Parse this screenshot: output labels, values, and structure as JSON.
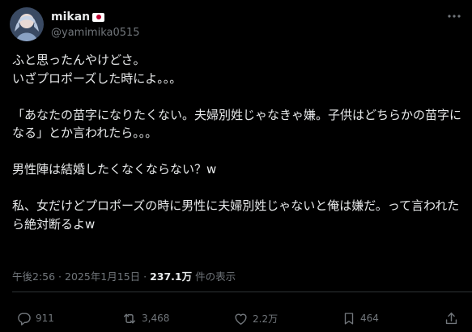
{
  "author": {
    "display_name": "mikan",
    "handle": "@yamimika0515",
    "flag": "japan-flag"
  },
  "post": {
    "text": "ふと思ったんやけどさ。\nいざプロポーズした時によ。。。\n\n「あなたの苗字になりたくない。夫婦別姓じゃなきゃ嫌。子供はどちらかの苗字になる」とか言われたら。。。\n\n男性陣は結婚したくなくならない？w\n\n私、女だけどプロポーズの時に男性に夫婦別姓じゃないと俺は嫌だ。って言われたら絶対断るよw"
  },
  "meta": {
    "timestamp": "午後2:56 · 2025年1月15日 · ",
    "views": "237.1万",
    "views_suffix": " 件の表示"
  },
  "actions": {
    "replies": "911",
    "reposts": "3,468",
    "likes": "2.2万",
    "bookmarks": "464"
  },
  "icons": {
    "more": "more-icon",
    "reply": "reply-icon",
    "repost": "repost-icon",
    "like": "like-icon",
    "bookmark": "bookmark-icon",
    "share": "share-icon"
  },
  "colors": {
    "background": "#000000",
    "text": "#e7e9ea",
    "secondary": "#71767b",
    "divider": "#2f3336",
    "flag_red": "#bc002d"
  }
}
